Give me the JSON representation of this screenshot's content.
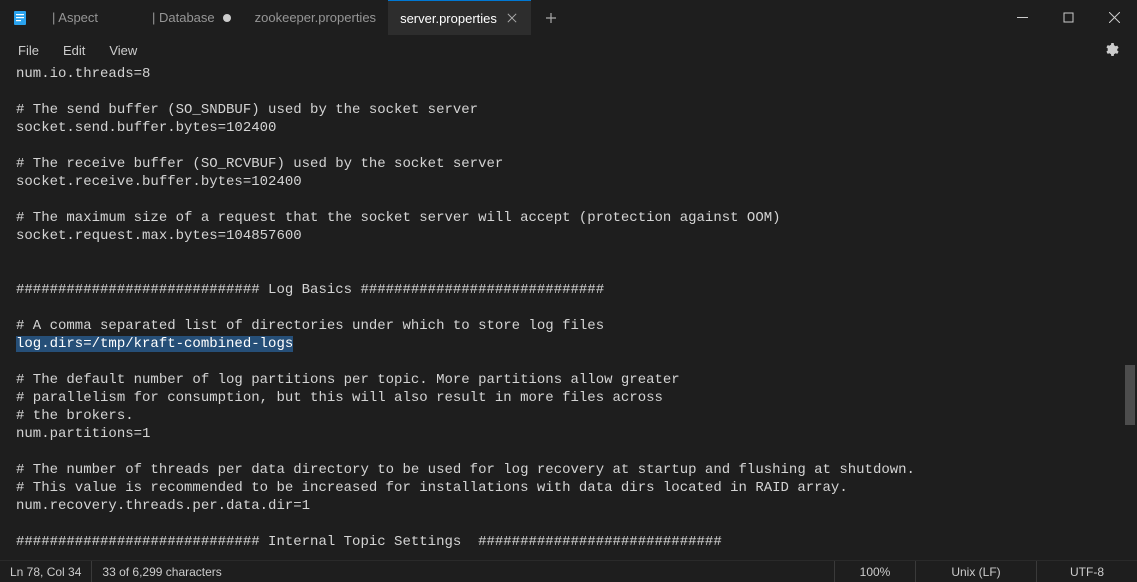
{
  "tabs": [
    {
      "label": "| Aspect",
      "modified": false,
      "active": false
    },
    {
      "label": "| Database",
      "modified": true,
      "active": false
    },
    {
      "label": "zookeeper.properties",
      "modified": false,
      "active": false
    },
    {
      "label": "server.properties",
      "modified": false,
      "active": true
    }
  ],
  "menu": {
    "file": "File",
    "edit": "Edit",
    "view": "View"
  },
  "editor": {
    "lines_before": "num.io.threads=8\n\n# The send buffer (SO_SNDBUF) used by the socket server\nsocket.send.buffer.bytes=102400\n\n# The receive buffer (SO_RCVBUF) used by the socket server\nsocket.receive.buffer.bytes=102400\n\n# The maximum size of a request that the socket server will accept (protection against OOM)\nsocket.request.max.bytes=104857600\n\n\n############################# Log Basics #############################\n\n# A comma separated list of directories under which to store log files\n",
    "selected": "log.dirs=/tmp/kraft-combined-logs",
    "lines_after": "\n\n# The default number of log partitions per topic. More partitions allow greater\n# parallelism for consumption, but this will also result in more files across\n# the brokers.\nnum.partitions=1\n\n# The number of threads per data directory to be used for log recovery at startup and flushing at shutdown.\n# This value is recommended to be increased for installations with data dirs located in RAID array.\nnum.recovery.threads.per.data.dir=1\n\n############################# Internal Topic Settings  #############################"
  },
  "status": {
    "pos": "Ln 78, Col 34",
    "chars": "33 of 6,299 characters",
    "zoom": "100%",
    "eol": "Unix (LF)",
    "encoding": "UTF-8"
  }
}
